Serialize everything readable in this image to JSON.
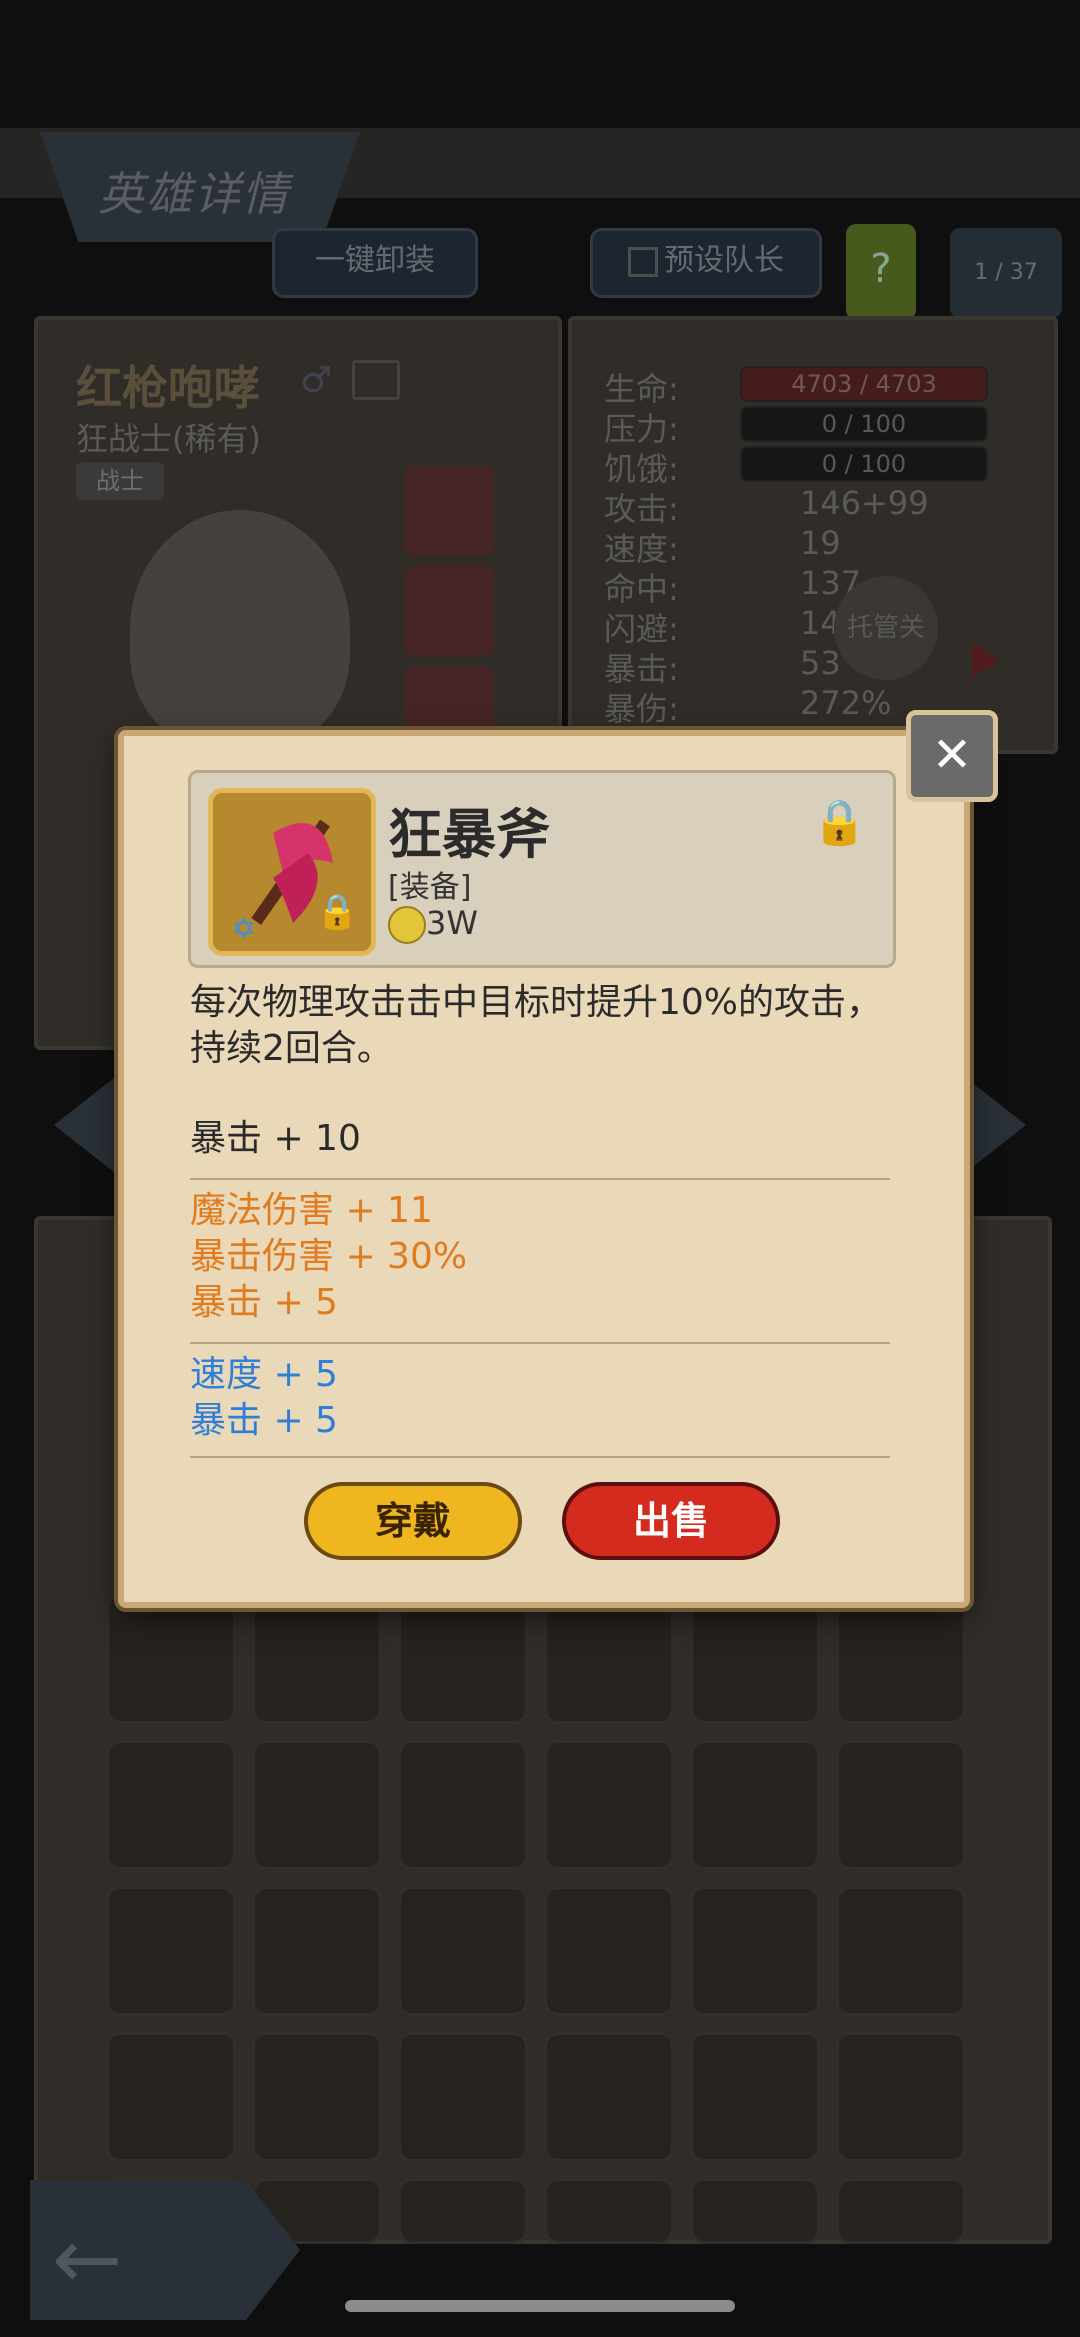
{
  "screen": {
    "title": "英雄详情",
    "unequip_all": "一键卸装",
    "preset_leader": "预设队长",
    "help": "?",
    "hero_index": "1 / 37"
  },
  "hero": {
    "name": "红枪咆哮",
    "class_rarity": "狂战士(稀有)",
    "role": "战士"
  },
  "stats": [
    {
      "label": "生命:",
      "value": "4703 / 4703",
      "kind": "hp"
    },
    {
      "label": "压力:",
      "value": "0 / 100",
      "kind": "bar"
    },
    {
      "label": "饥饿:",
      "value": "0 / 100",
      "kind": "bar"
    },
    {
      "label": "攻击:",
      "value": "146+99"
    },
    {
      "label": "速度:",
      "value": "19"
    },
    {
      "label": "命中:",
      "value": "137"
    },
    {
      "label": "闪避:",
      "value": "14"
    },
    {
      "label": "暴击:",
      "value": "53"
    },
    {
      "label": "暴伤:",
      "value": "272%"
    }
  ],
  "auto_badge": "托管关",
  "item": {
    "name": "狂暴斧",
    "type": "[装备]",
    "price": "3W",
    "description": "每次物理攻击击中目标时提升10%的攻击，持续2回合。",
    "base_stats": [
      "暴击 + 10"
    ],
    "orange_stats": [
      "魔法伤害 + 11",
      "暴击伤害 + 30%",
      "暴击 + 5"
    ],
    "blue_stats": [
      "速度 + 5",
      "暴击 + 5"
    ],
    "equip_label": "穿戴",
    "sell_label": "出售"
  },
  "colors": {
    "orange": "#e07b1f",
    "blue": "#2f7fd8",
    "equip": "#f0b620",
    "sell": "#d52a1e"
  }
}
